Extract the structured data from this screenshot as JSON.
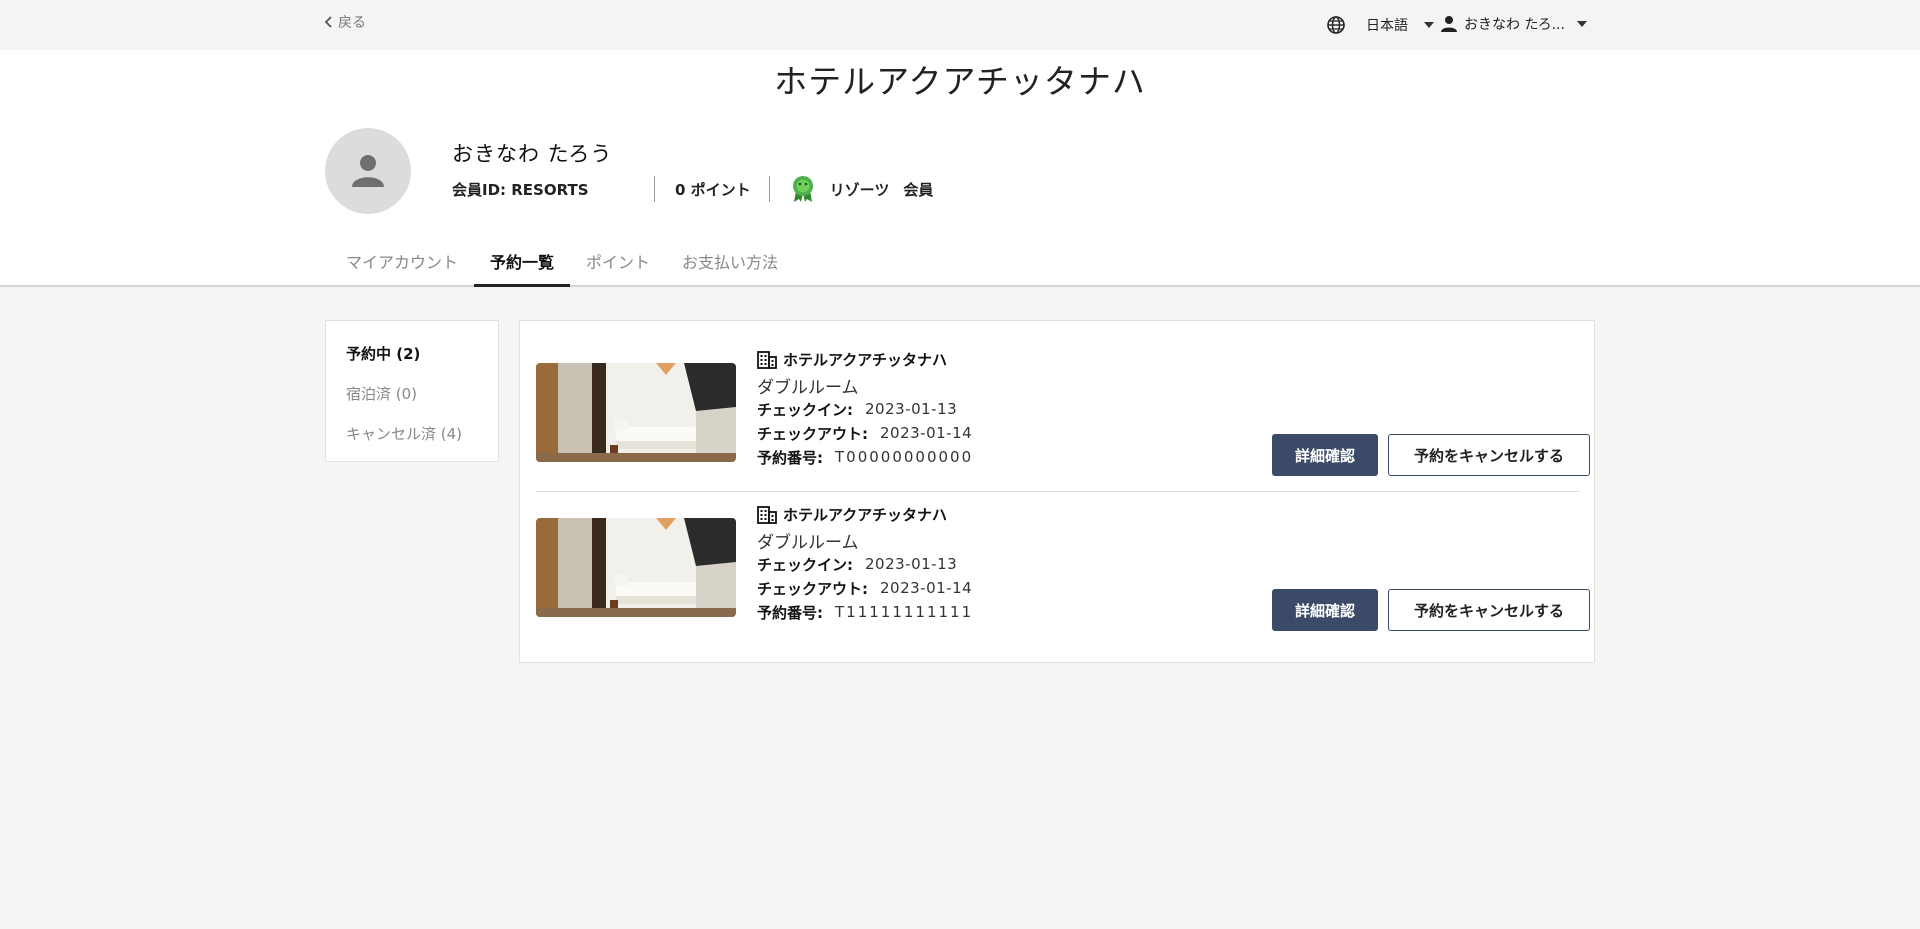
{
  "topbar": {
    "back_label": "戻る",
    "language_label": "日本語",
    "user_label": "おきなわ たろ..."
  },
  "header": {
    "hotel_title": "ホテルアクアチッタナハ",
    "user_name": "おきなわ たろう",
    "member_id": "会員ID: RESORTS",
    "points": "0 ポイント",
    "rank_name": "リゾーツ",
    "rank_suffix": "会員"
  },
  "tabs": [
    {
      "label": "マイアカウント",
      "active": false
    },
    {
      "label": "予約一覧",
      "active": true
    },
    {
      "label": "ポイント",
      "active": false
    },
    {
      "label": "お支払い方法",
      "active": false
    }
  ],
  "sidebar": {
    "items": [
      {
        "label": "予約中 (2)",
        "active": true
      },
      {
        "label": "宿泊済 (0)",
        "active": false
      },
      {
        "label": "キャンセル済 (4)",
        "active": false
      }
    ]
  },
  "bookings": [
    {
      "hotel": "ホテルアクアチッタナハ",
      "room": "ダブルルーム",
      "checkin_label": "チェックイン:",
      "checkin": "2023-01-13",
      "checkout_label": "チェックアウト:",
      "checkout": "2023-01-14",
      "number_label": "予約番号:",
      "number": "T00000000000",
      "detail_button": "詳細確認",
      "cancel_button": "予約をキャンセルする"
    },
    {
      "hotel": "ホテルアクアチッタナハ",
      "room": "ダブルルーム",
      "checkin_label": "チェックイン:",
      "checkin": "2023-01-13",
      "checkout_label": "チェックアウト:",
      "checkout": "2023-01-14",
      "number_label": "予約番号:",
      "number": "T11111111111",
      "detail_button": "詳細確認",
      "cancel_button": "予約をキャンセルする"
    }
  ],
  "colors": {
    "primary_button": "#3b4a66",
    "rank_badge": "#3a9a3a"
  }
}
